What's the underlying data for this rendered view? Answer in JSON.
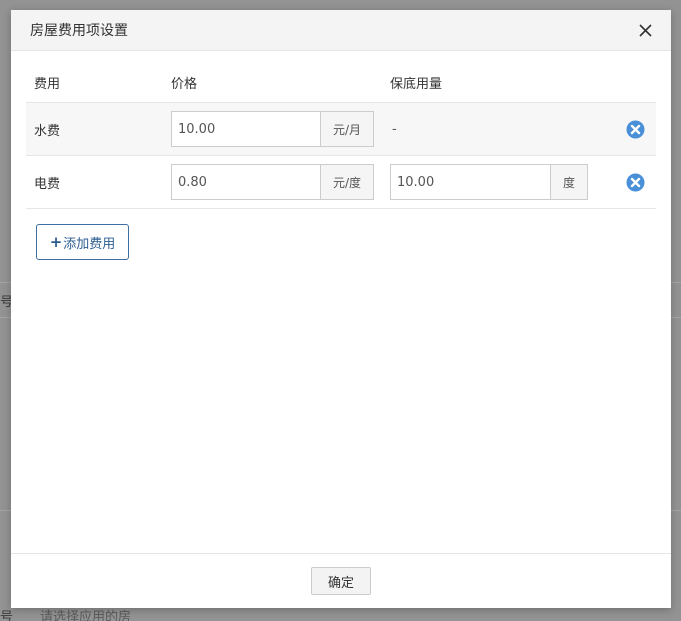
{
  "background": {
    "label_top": "号",
    "label_bottom": "号",
    "placeholder_bottom": "请选择应用的房"
  },
  "modal": {
    "title": "房屋费用项设置",
    "close_icon": "close-icon",
    "columns": {
      "name": "费用",
      "price": "价格",
      "base": "保底用量"
    },
    "rows": [
      {
        "name": "水费",
        "price": "10.00",
        "price_unit": "元/月",
        "base": "-",
        "base_unit": ""
      },
      {
        "name": "电费",
        "price": "0.80",
        "price_unit": "元/度",
        "base": "10.00",
        "base_unit": "度"
      }
    ],
    "add_button": {
      "icon": "+",
      "label": "添加费用"
    },
    "confirm_button": "确定"
  },
  "colors": {
    "accent": "#2c5d8f",
    "delete_icon": "#4a90d9"
  }
}
